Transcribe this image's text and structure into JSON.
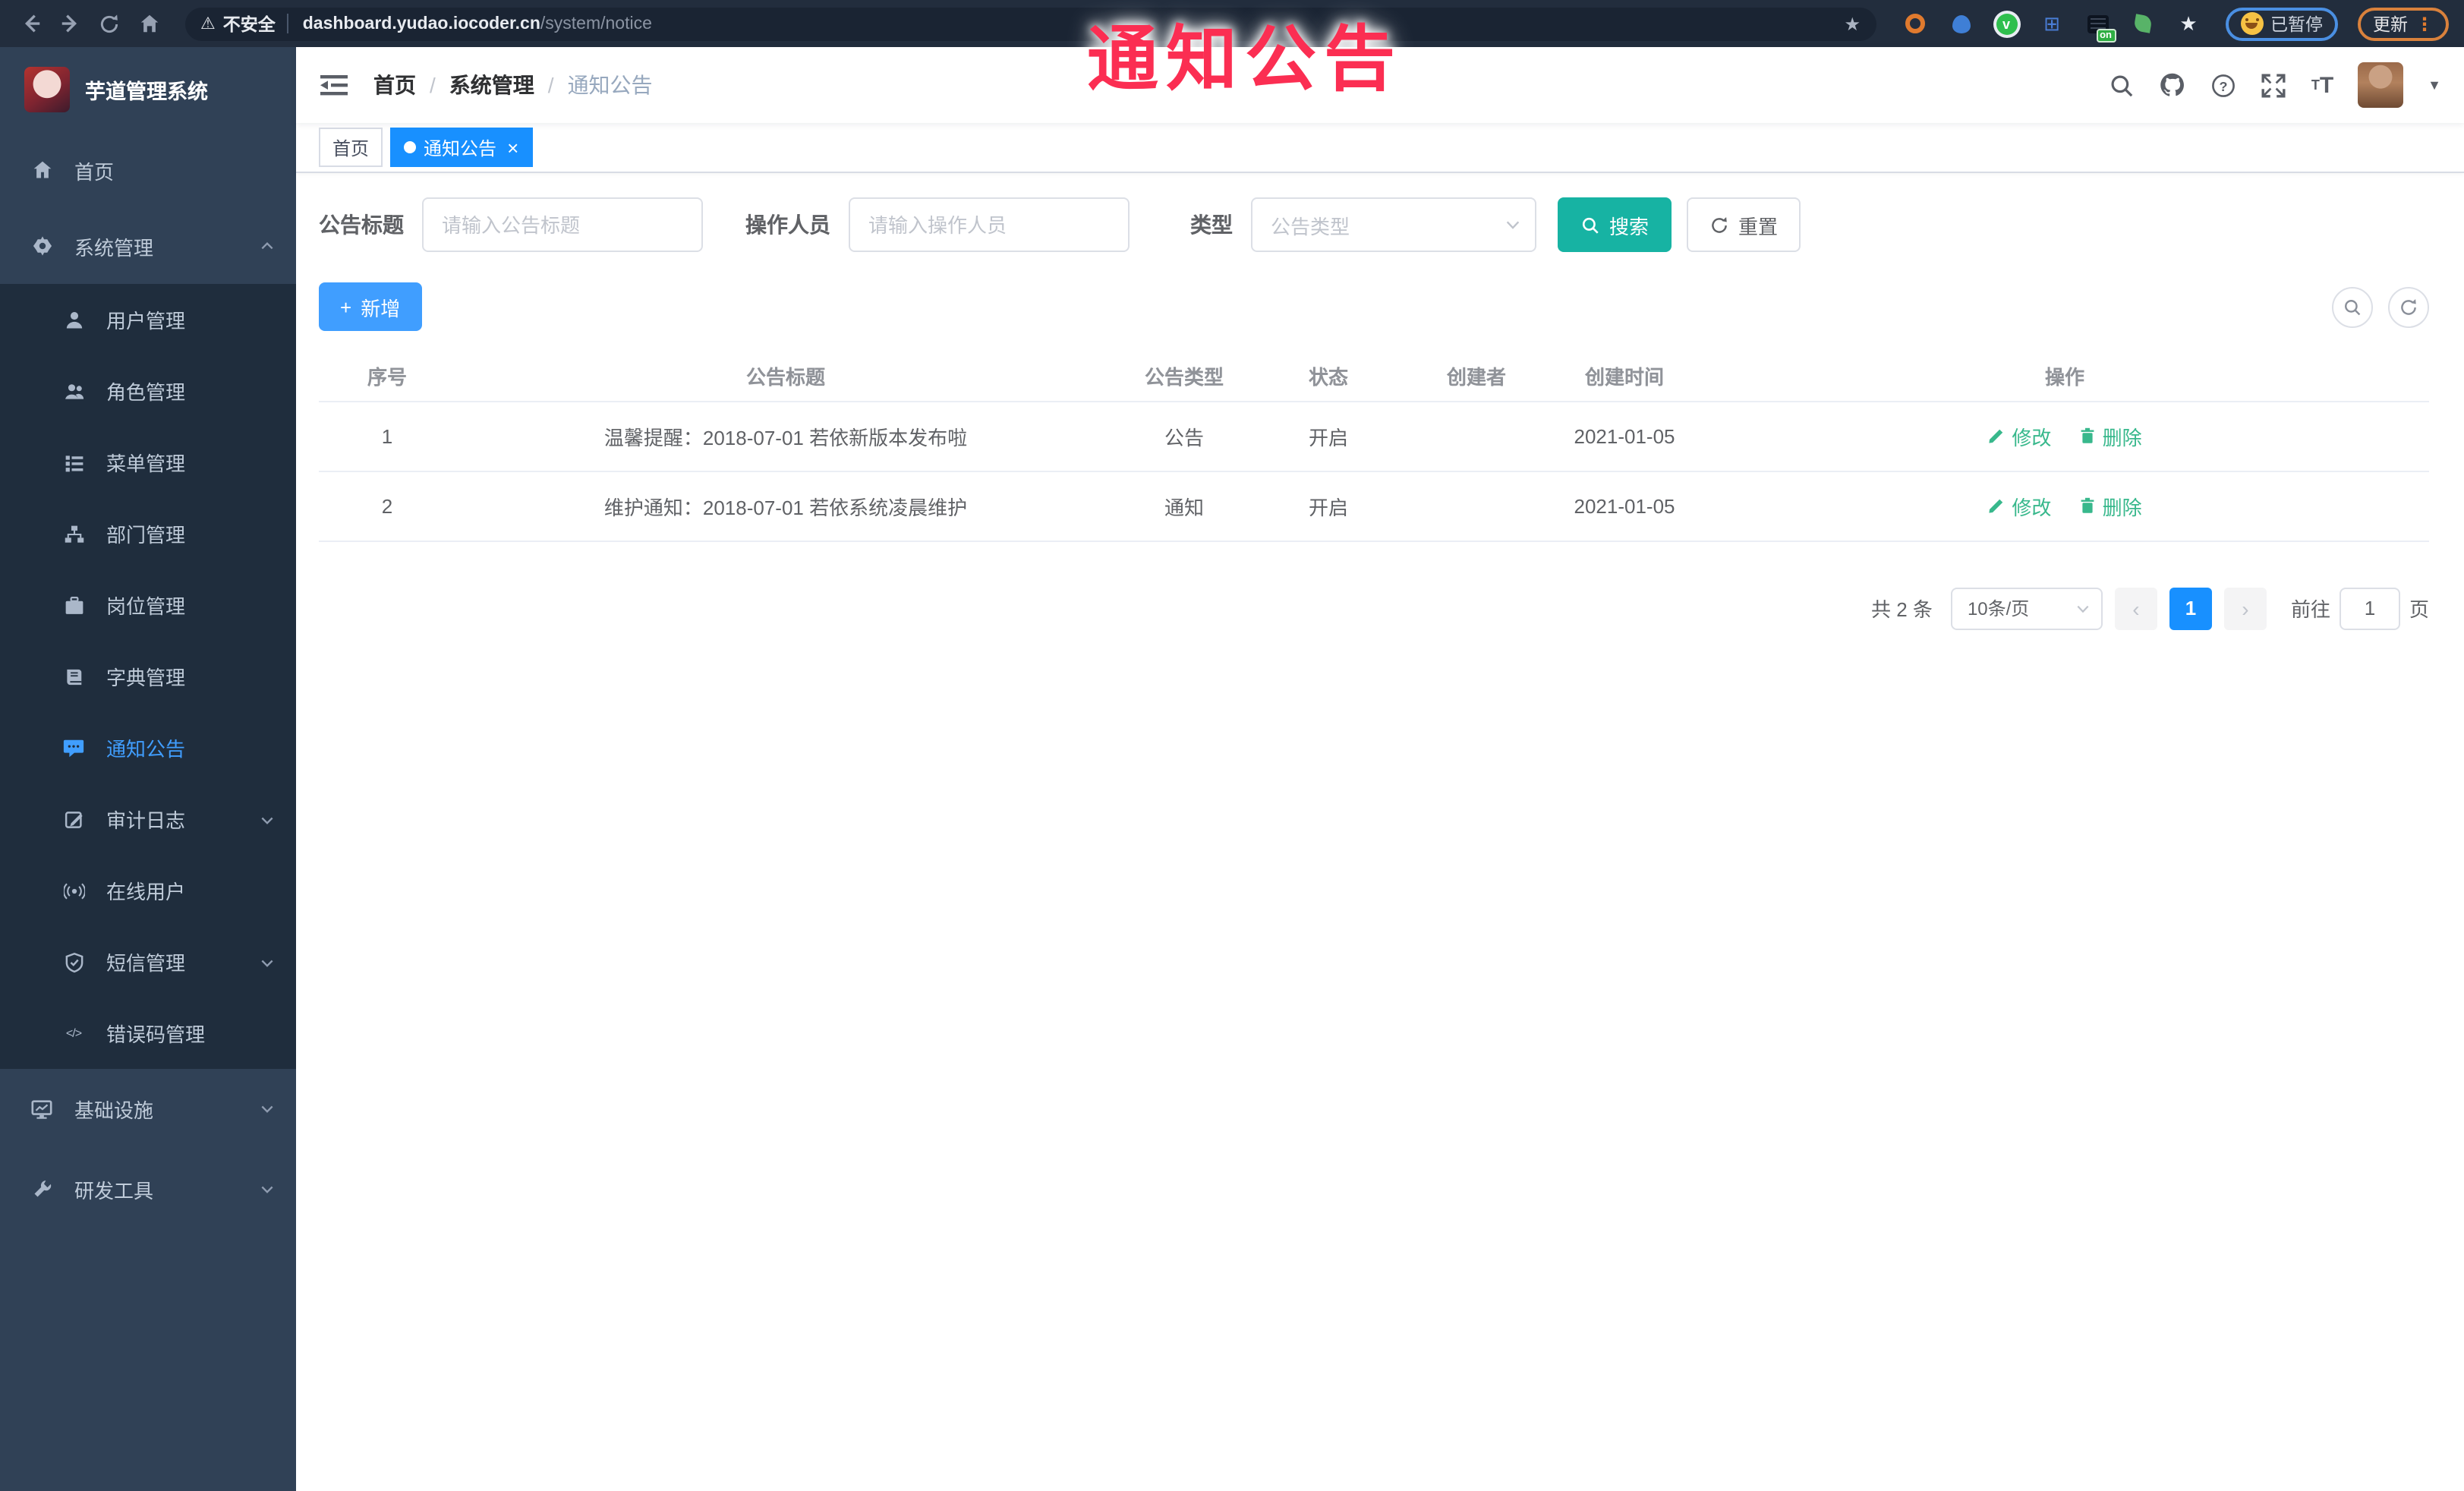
{
  "browser": {
    "security": "不安全",
    "url_host": "dashboard.yudao.iocoder.cn",
    "url_path": "/system/notice",
    "profile_label": "已暂停",
    "update_label": "更新",
    "extension_badge": "on"
  },
  "watermark": {
    "text": "通知公告",
    "color": "#fb2e52"
  },
  "sidebar": {
    "title": "芋道管理系统",
    "items": [
      {
        "label": "首页"
      },
      {
        "label": "系统管理"
      },
      {
        "label": "用户管理"
      },
      {
        "label": "角色管理"
      },
      {
        "label": "菜单管理"
      },
      {
        "label": "部门管理"
      },
      {
        "label": "岗位管理"
      },
      {
        "label": "字典管理"
      },
      {
        "label": "通知公告"
      },
      {
        "label": "审计日志"
      },
      {
        "label": "在线用户"
      },
      {
        "label": "短信管理"
      },
      {
        "label": "错误码管理"
      },
      {
        "label": "基础设施"
      },
      {
        "label": "研发工具"
      }
    ],
    "active_item": "通知公告"
  },
  "breadcrumb": {
    "items": [
      "首页",
      "系统管理",
      "通知公告"
    ]
  },
  "tags": {
    "home": "首页",
    "active": "通知公告"
  },
  "filters": {
    "title_label": "公告标题",
    "title_placeholder": "请输入公告标题",
    "operator_label": "操作人员",
    "operator_placeholder": "请输入操作人员",
    "type_label": "类型",
    "type_placeholder": "公告类型",
    "search_label": "搜索",
    "reset_label": "重置"
  },
  "toolbar": {
    "add_label": "新增"
  },
  "table": {
    "headers": [
      "序号",
      "公告标题",
      "公告类型",
      "状态",
      "创建者",
      "创建时间",
      "操作"
    ],
    "rows": [
      {
        "no": "1",
        "title": "温馨提醒：2018-07-01 若依新版本发布啦",
        "type": "公告",
        "status": "开启",
        "creator": "",
        "created": "2021-01-05"
      },
      {
        "no": "2",
        "title": "维护通知：2018-07-01 若依系统凌晨维护",
        "type": "通知",
        "status": "开启",
        "creator": "",
        "created": "2021-01-05"
      }
    ],
    "edit_label": "修改",
    "delete_label": "删除"
  },
  "pagination": {
    "total": "共 2 条",
    "page_size": "10条/页",
    "current_page": "1",
    "goto_prefix": "前往",
    "goto_value": "1",
    "goto_suffix": "页"
  },
  "glyphs": {
    "warning": "⚠",
    "bookmark_star": "★",
    "ext_grid": "⊞",
    "ext_puzzle": "★",
    "ext_check": "v",
    "menu_dots": "⋮",
    "caret_down": "▼",
    "tag_close": "×",
    "plus": "+",
    "sep_slash": "/",
    "prev_arrow": "‹",
    "next_arrow": "›",
    "help_mark": "?",
    "font_large": "T",
    "font_small": "T",
    "code_icon": "</>"
  },
  "colors": {
    "accent_blue": "#409eff",
    "tag_active_blue": "#1890ff",
    "search_teal": "#17b3a3",
    "action_green": "#38b88c",
    "sidebar_bg": "#304156",
    "submenu_bg": "#1f2d3d",
    "browser_bar_bg": "#222d3d",
    "watermark_red": "#fb2e52"
  }
}
